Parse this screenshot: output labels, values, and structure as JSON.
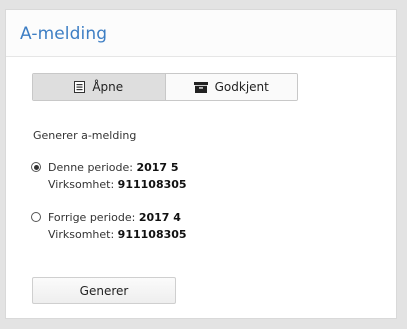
{
  "card": {
    "title": "A-melding"
  },
  "status_toggle": {
    "open": {
      "label": "Åpne",
      "icon": "document-icon",
      "selected": true
    },
    "approved": {
      "label": "Godkjent",
      "icon": "archive-box-icon",
      "selected": false
    }
  },
  "generate_section": {
    "label": "Generer a-melding",
    "options": [
      {
        "selected": true,
        "period_label": "Denne periode: ",
        "period_value": "2017 5",
        "company_label": "Virksomhet: ",
        "company_value": "911108305"
      },
      {
        "selected": false,
        "period_label": "Forrige periode: ",
        "period_value": "2017 4",
        "company_label": "Virksomhet: ",
        "company_value": "911108305"
      }
    ],
    "button_label": "Generer"
  },
  "colors": {
    "title": "#3d7ec4",
    "active_toggle_bg": "#dedede",
    "page_bg": "#e3e3e3"
  }
}
